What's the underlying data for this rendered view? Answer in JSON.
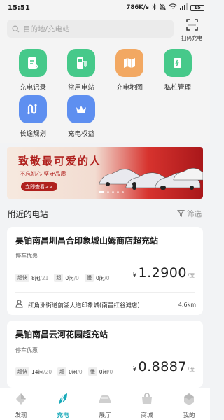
{
  "status_bar": {
    "time": "15:51",
    "network_speed": "786K/s",
    "battery": "15"
  },
  "search": {
    "placeholder": "目的地/充电站"
  },
  "scan": {
    "label": "扫码充电",
    "icon": "scan-icon"
  },
  "quick_actions": [
    {
      "label": "充电记录",
      "icon": "charge-record-icon",
      "color": "#46c98a"
    },
    {
      "label": "常用电站",
      "icon": "favorite-station-icon",
      "color": "#46c98a"
    },
    {
      "label": "充电地图",
      "icon": "charge-map-icon",
      "color": "#f2a862"
    },
    {
      "label": "私桩管理",
      "icon": "private-pile-icon",
      "color": "#46c98a"
    },
    {
      "label": "长途规划",
      "icon": "long-trip-icon",
      "color": "#5e8ff0"
    },
    {
      "label": "充电权益",
      "icon": "charge-benefit-icon",
      "color": "#5e8ff0"
    }
  ],
  "banner": {
    "title": "致敬最可爱的人",
    "subtitle": "不忘初心 坚守品质",
    "button": "立即查看>>",
    "slides": 5,
    "active_slide": 0
  },
  "nearby": {
    "title": "附近的电站",
    "filter_label": "筛选"
  },
  "stations": [
    {
      "name": "昊铂南昌圳昌合印象城山姆商店超充站",
      "parking": "停车优惠",
      "chargers": [
        {
          "tag": "超快",
          "free": "8闲",
          "total": "/21"
        },
        {
          "tag": "超",
          "free": "0闲",
          "total": "/0"
        },
        {
          "tag": "慢",
          "free": "0闲",
          "total": "/0"
        }
      ],
      "price_currency": "¥",
      "price": "1.2900",
      "price_unit": "/度",
      "address": "红角洲街道前湖大道印象城(南昌红谷滩店)",
      "distance": "4.6km"
    },
    {
      "name": "昊铂南昌云河花园超充站",
      "parking": "停车优惠",
      "chargers": [
        {
          "tag": "超快",
          "free": "14闲",
          "total": "/20"
        },
        {
          "tag": "超",
          "free": "0闲",
          "total": "/0"
        },
        {
          "tag": "慢",
          "free": "0闲",
          "total": "/0"
        }
      ],
      "price_currency": "¥",
      "price": "0.8887",
      "price_unit": "/度"
    }
  ],
  "bottom_nav": [
    {
      "label": "发现",
      "icon": "discover-icon",
      "active": false
    },
    {
      "label": "充电",
      "icon": "charge-icon",
      "active": true
    },
    {
      "label": "展厅",
      "icon": "showroom-car-icon",
      "active": false
    },
    {
      "label": "商城",
      "icon": "mall-icon",
      "active": false
    },
    {
      "label": "我的",
      "icon": "profile-icon",
      "active": false
    }
  ],
  "colors": {
    "accent": "#16a9b9",
    "green_icon": "#46c98a",
    "blue_icon": "#5e8ff0",
    "orange_icon": "#f2a862"
  }
}
